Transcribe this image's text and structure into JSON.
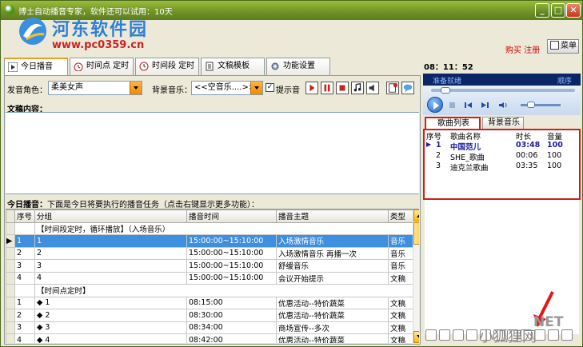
{
  "window": {
    "title": "博士自动播音专家，软件还可以试用：10天",
    "min": "_",
    "max": "□",
    "close": "✕"
  },
  "watermark": {
    "site_name": "河东软件园",
    "url": "www.pc0359.cn",
    "fox": "小狐狸网",
    "fox_suffix": "NET"
  },
  "header": {
    "buy_register": "购买 注册",
    "menu_label": "菜单"
  },
  "tabs": [
    {
      "label": "今日播音",
      "active": true
    },
    {
      "label": "时间点 定时",
      "active": false
    },
    {
      "label": "时间段 定时",
      "active": false
    },
    {
      "label": "文稿模板",
      "active": false
    },
    {
      "label": "功能设置",
      "active": false
    }
  ],
  "clock": "08：11：52",
  "settings": {
    "voice_label": "发音角色：",
    "voice_value": "柔美女声",
    "bgm_label": "背景音乐：",
    "bgm_value": "<<空音乐....>>",
    "prompt_label": "提示音",
    "prompt_checked": true
  },
  "doc": {
    "label": "文稿内容："
  },
  "today": {
    "label_bold": "今日播音：",
    "label_desc": "下面是今日将要执行的播音任务（点击右键显示更多功能）："
  },
  "task_table": {
    "columns": [
      "序号",
      "分组",
      "播音时间",
      "播音主题",
      "类型"
    ],
    "rows": [
      {
        "kind": "group",
        "num": "",
        "group": "【时间段定时，循环播放】（入场音乐）",
        "time": "",
        "topic": "",
        "type": ""
      },
      {
        "kind": "row",
        "num": "1",
        "group": "1",
        "time": "15:00:00~15:10:00",
        "topic": "入场激情音乐",
        "type": "音乐",
        "selected": true
      },
      {
        "kind": "row",
        "num": "2",
        "group": "2",
        "time": "15:00:00~15:10:00",
        "topic": "入场激情音乐 再播一次",
        "type": "音乐"
      },
      {
        "kind": "row",
        "num": "3",
        "group": "3",
        "time": "15:00:00~15:10:00",
        "topic": "舒缓音乐",
        "type": "音乐"
      },
      {
        "kind": "row",
        "num": "4",
        "group": "4",
        "time": "15:00:00~15:10:00",
        "topic": "会议开始提示",
        "type": "文稿"
      },
      {
        "kind": "group",
        "num": "",
        "group": "【时间点定时】",
        "time": "",
        "topic": "",
        "type": ""
      },
      {
        "kind": "row",
        "num": "1",
        "group": "◆ 1",
        "time": "08:15:00",
        "topic": "优惠活动--特价蔬菜",
        "type": "文稿"
      },
      {
        "kind": "row",
        "num": "2",
        "group": "◆ 2",
        "time": "08:30:00",
        "topic": "优惠活动--特价蔬菜",
        "type": "文稿"
      },
      {
        "kind": "row",
        "num": "3",
        "group": "◆ 3",
        "time": "08:34:00",
        "topic": "商场宣传--多次",
        "type": "文稿"
      },
      {
        "kind": "row",
        "num": "4",
        "group": "◆ 4",
        "time": "08:42:00",
        "topic": "优惠活动--特价蔬菜",
        "type": "文稿"
      }
    ]
  },
  "player": {
    "status": "准备就绪",
    "order": "顺序"
  },
  "right_tabs": {
    "song_list": "歌曲列表",
    "bg_music": "背景音乐"
  },
  "song_table": {
    "columns": [
      "序号",
      "歌曲名称",
      "时长",
      "音量"
    ],
    "rows": [
      {
        "num": "1",
        "name": "中国范儿",
        "duration": "03:48",
        "volume": "100",
        "playing": true
      },
      {
        "num": "2",
        "name": "SHE_歌曲",
        "duration": "00:06",
        "volume": "100"
      },
      {
        "num": "3",
        "name": "迪克兰歌曲",
        "duration": "03:35",
        "volume": "100"
      }
    ]
  },
  "colors": {
    "title_bar": "#6f9127",
    "selected_row": "#3f8fe0",
    "highlight_box": "#d31d1d",
    "accent_orange": "#f08a00"
  }
}
